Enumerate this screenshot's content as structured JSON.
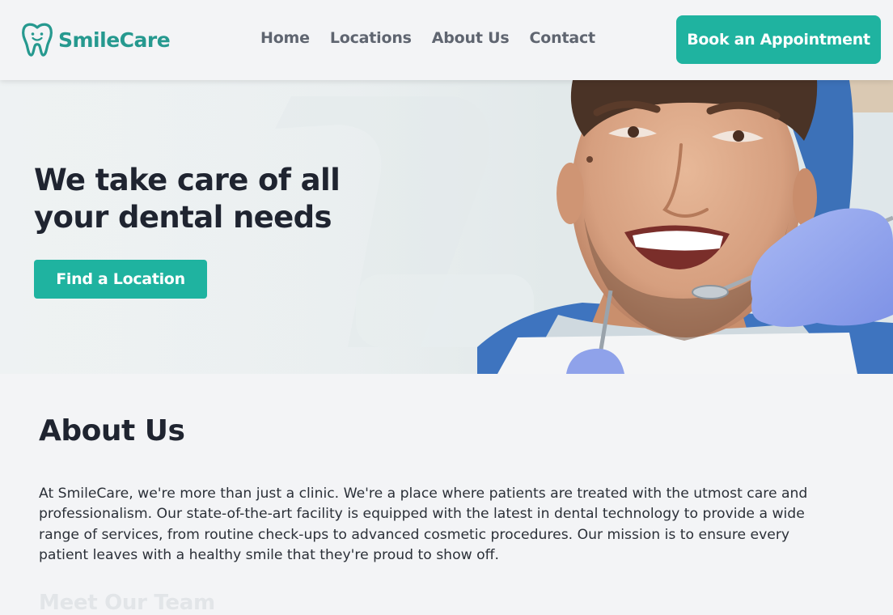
{
  "brand": {
    "name": "SmileCare",
    "color": "#26998f"
  },
  "nav": {
    "items": [
      "Home",
      "Locations",
      "About Us",
      "Contact"
    ]
  },
  "header": {
    "cta_label": "Book an Appointment",
    "accent": "#1fb3a0"
  },
  "hero": {
    "title_line1": "We take care of all",
    "title_line2": "your dental needs",
    "button_label": "Find a Location"
  },
  "about": {
    "heading": "About Us",
    "body": "At SmileCare, we're more than just a clinic. We're a place where patients are treated with the utmost care and professionalism. Our state-of-the-art facility is equipped with the latest in dental technology to provide a wide range of services, from routine check-ups to advanced cosmetic procedures. Our mission is to ensure every patient leaves with a healthy smile that they're proud to show off."
  },
  "team": {
    "heading": "Meet Our Team"
  }
}
